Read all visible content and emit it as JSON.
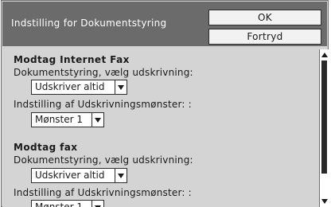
{
  "header": {
    "title": "Indstilling for Dokumentstyring",
    "ok_label": "OK",
    "cancel_label": "Fortryd"
  },
  "sections": [
    {
      "title": "Modtag Internet Fax",
      "print_label": "Dokumentstyring, vælg udskrivning:",
      "print_value": "Udskriver altid",
      "pattern_label": "Indstilling af Udskrivningsmønster: :",
      "pattern_value": "Mønster 1"
    },
    {
      "title": "Modtag fax",
      "print_label": "Dokumentstyring, vælg udskrivning:",
      "print_value": "Udskriver altid",
      "pattern_label": "Indstilling af Udskrivningsmønster: :",
      "pattern_value": "Mønster 1"
    }
  ],
  "icons": {
    "dropdown": "chevron-down-icon",
    "scroll_up": "arrow-up-icon",
    "scroll_down": "arrow-down-icon"
  },
  "colors": {
    "header_bg": "#6b6b6b",
    "panel_bg": "#d4d4d4",
    "text": "#1a1a1a"
  }
}
